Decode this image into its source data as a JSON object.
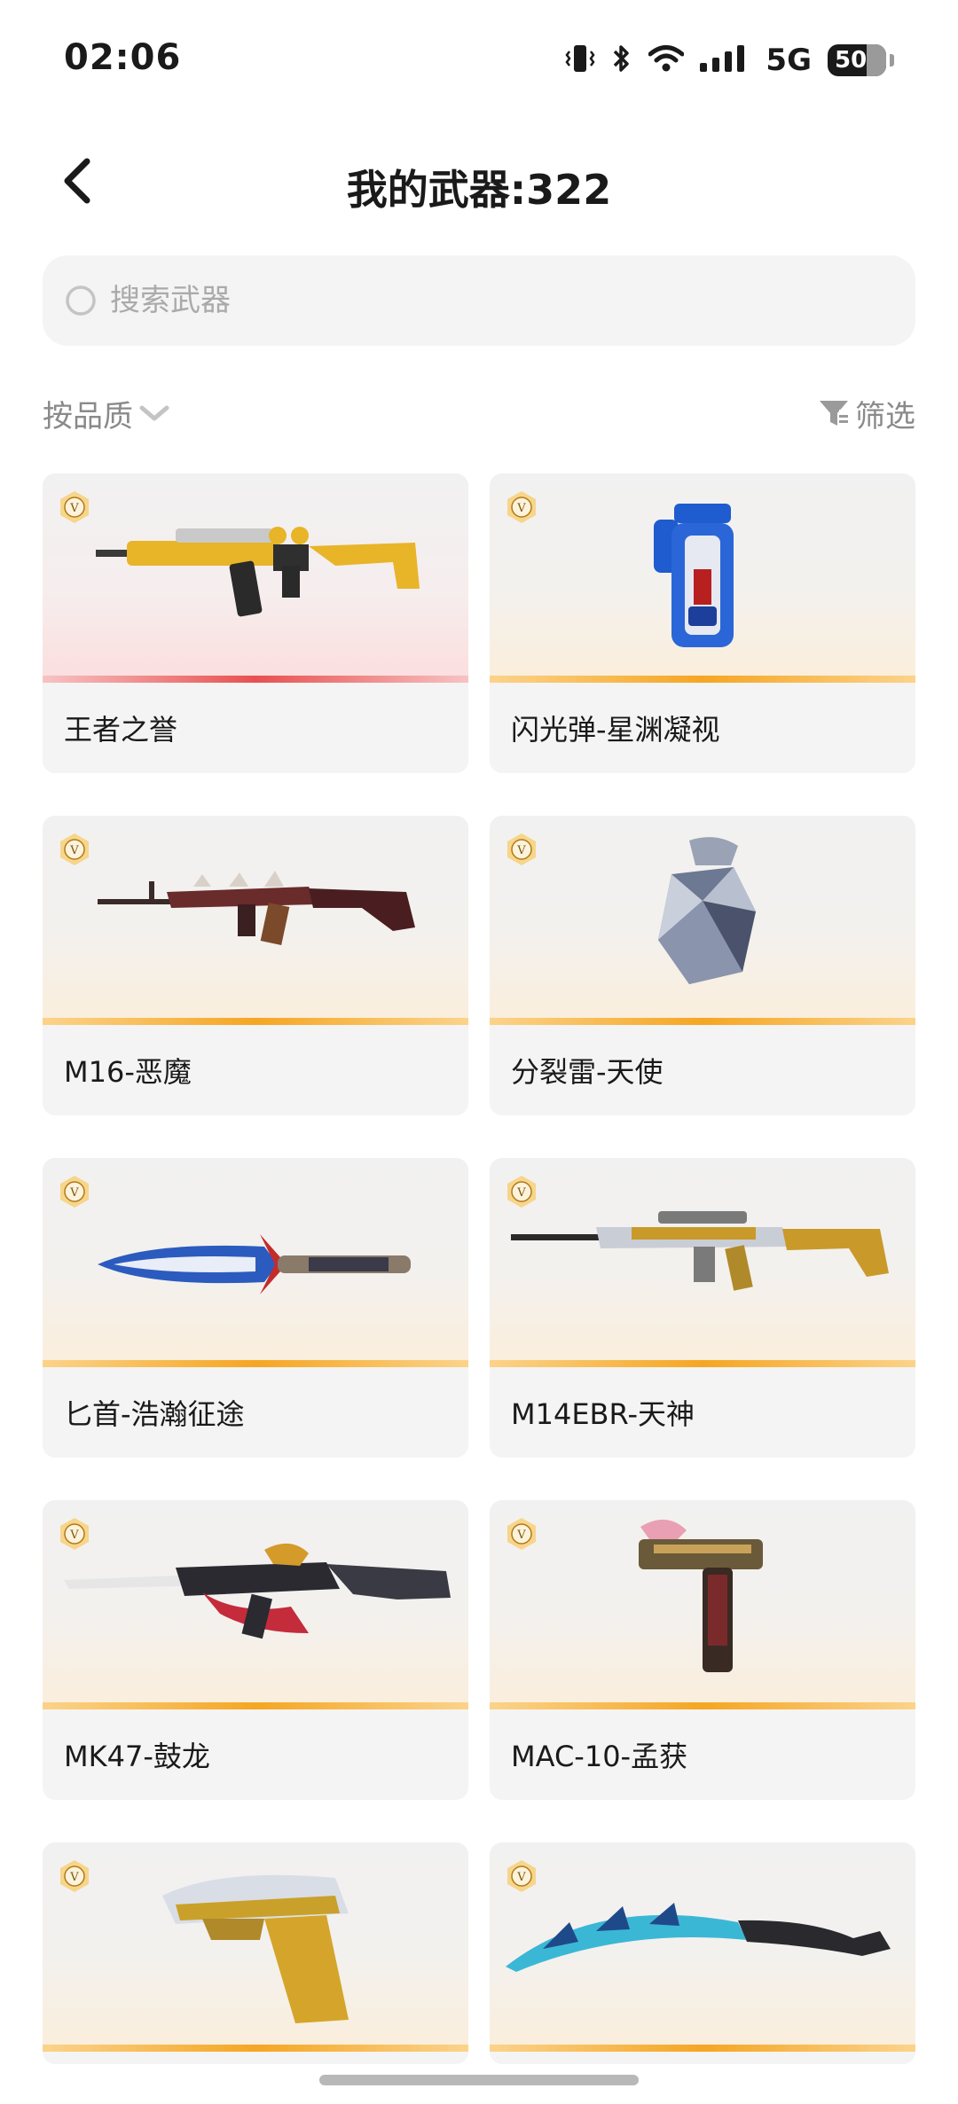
{
  "status_bar": {
    "time": "02:06",
    "network": "5G",
    "battery": "50"
  },
  "header": {
    "title": "我的武器:322"
  },
  "search": {
    "placeholder": "搜索武器"
  },
  "toolbar": {
    "sort_label": "按品质",
    "filter_label": "筛选"
  },
  "colors": {
    "gold_stripe": "#f5a623",
    "red_stripe": "#e85050",
    "card_bg": "#f4f4f4",
    "muted_text": "#8a8a8a"
  },
  "weapons": [
    {
      "name": "王者之誉",
      "quality": "red",
      "icon": "rifle-gold-icon"
    },
    {
      "name": "闪光弹-星渊凝视",
      "quality": "gold",
      "icon": "flashbang-icon"
    },
    {
      "name": "M16-恶魔",
      "quality": "gold",
      "icon": "rifle-demon-icon"
    },
    {
      "name": "分裂雷-天使",
      "quality": "gold",
      "icon": "grenade-icon"
    },
    {
      "name": "匕首-浩瀚征途",
      "quality": "gold",
      "icon": "dagger-icon"
    },
    {
      "name": "M14EBR-天神",
      "quality": "gold",
      "icon": "sniper-rifle-icon"
    },
    {
      "name": "MK47-鼓龙",
      "quality": "gold",
      "icon": "rifle-dragon-icon"
    },
    {
      "name": "MAC-10-孟获",
      "quality": "gold",
      "icon": "smg-icon"
    },
    {
      "name": "",
      "quality": "gold",
      "icon": "pistol-dragon-icon"
    },
    {
      "name": "",
      "quality": "gold",
      "icon": "curved-blade-icon"
    }
  ]
}
